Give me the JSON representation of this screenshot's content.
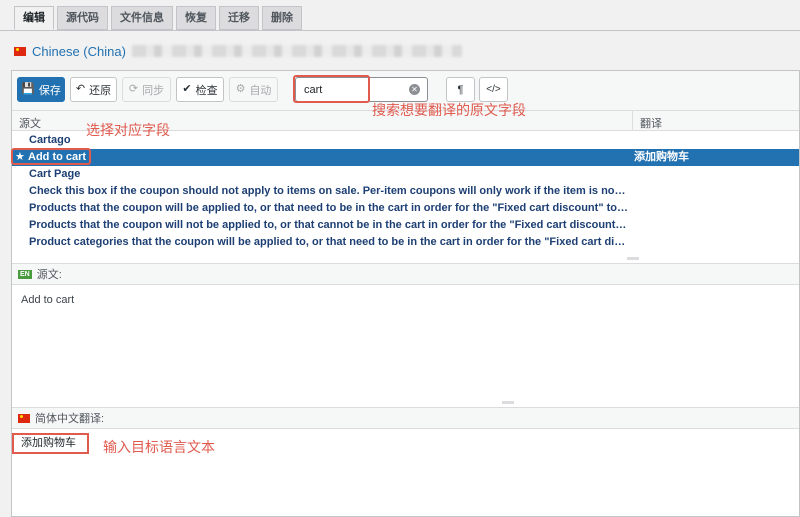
{
  "tabs": [
    {
      "label": "编辑",
      "active": true
    },
    {
      "label": "源代码",
      "active": false
    },
    {
      "label": "文件信息",
      "active": false
    },
    {
      "label": "恢复",
      "active": false
    },
    {
      "label": "迁移",
      "active": false
    },
    {
      "label": "删除",
      "active": false
    }
  ],
  "locale": {
    "name": "Chinese (China)",
    "flag_icon": "flag-cn-icon"
  },
  "toolbar": {
    "save": "保存",
    "revert": "还原",
    "sync": "同步",
    "check": "检查",
    "auto": "自动",
    "search_value": "cart",
    "pilcrow": "¶",
    "code": "</>"
  },
  "list": {
    "col_source": "源文",
    "col_translation": "翻译",
    "rows": [
      {
        "source": "Cartago",
        "translation": "",
        "selected": false
      },
      {
        "source": "Add to cart",
        "translation": "添加购物车",
        "selected": true
      },
      {
        "source": "Cart Page",
        "translation": "",
        "selected": false
      },
      {
        "source": "Check this box if the coupon should not apply to items on sale. Per-item coupons will only work if the item is not on sale. P...",
        "translation": "",
        "selected": false
      },
      {
        "source": "Products that the coupon will be applied to, or that need to be in the cart in order for the \"Fixed cart discount\" to be appli...",
        "translation": "",
        "selected": false
      },
      {
        "source": "Products that the coupon will not be applied to, or that cannot be in the cart in order for the \"Fixed cart discount\" to be a...",
        "translation": "",
        "selected": false
      },
      {
        "source": "Product categories that the coupon will be applied to, or that need to be in the cart in order for the \"Fixed cart discount\" t...",
        "translation": "",
        "selected": false
      }
    ]
  },
  "source_section": {
    "badge": "EN",
    "label": "源文:",
    "text": "Add to cart"
  },
  "translation_section": {
    "label": "简体中文翻译:",
    "value": "添加购物车"
  },
  "annotations": {
    "search_hint": "搜索想要翻译的原文字段",
    "select_hint": "选择对应字段",
    "input_hint": "输入目标语言文本"
  },
  "colors": {
    "accent": "#2271b1",
    "annotation": "#e05a4e"
  }
}
